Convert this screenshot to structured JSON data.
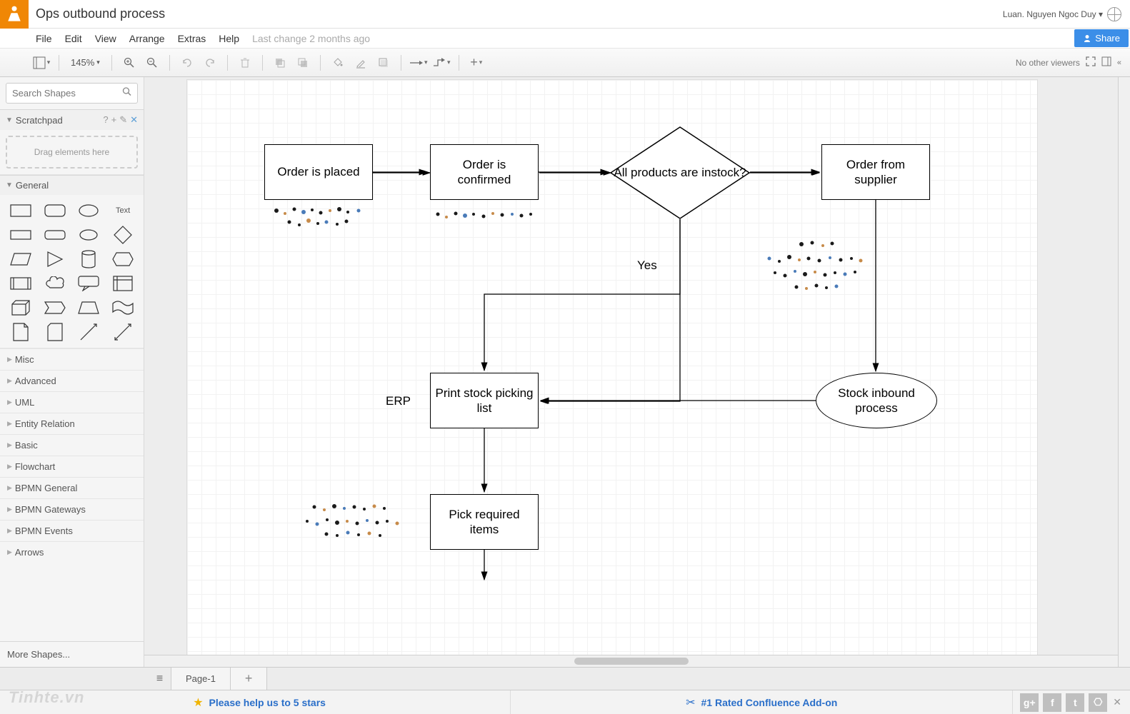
{
  "header": {
    "title": "Ops outbound process",
    "user": "Luan. Nguyen Ngoc Duy",
    "share": "Share"
  },
  "menubar": {
    "items": [
      "File",
      "Edit",
      "View",
      "Arrange",
      "Extras",
      "Help"
    ],
    "lastchange": "Last change 2 months ago"
  },
  "toolbar": {
    "zoom": "145%",
    "right": "No other viewers"
  },
  "sidebar": {
    "search_placeholder": "Search Shapes",
    "scratchpad": "Scratchpad",
    "dropzone": "Drag elements here",
    "general": "General",
    "text_shape": "Text",
    "cats": [
      "Misc",
      "Advanced",
      "UML",
      "Entity Relation",
      "Basic",
      "Flowchart",
      "BPMN General",
      "BPMN Gateways",
      "BPMN Events",
      "Arrows"
    ],
    "more": "More Shapes..."
  },
  "diagram": {
    "n1": "Order is placed",
    "n2": "Order is confirmed",
    "n3": "All products are instock?",
    "n4": "Order from supplier",
    "n5": "Print stock picking list",
    "n6": "Stock inbound process",
    "n7": "Pick required items",
    "yes": "Yes",
    "erp": "ERP"
  },
  "tabs": {
    "page1": "Page-1"
  },
  "footer": {
    "left": "Please help us to 5 stars",
    "right": "#1 Rated Confluence Add-on"
  },
  "watermark": "Tinhte.vn"
}
